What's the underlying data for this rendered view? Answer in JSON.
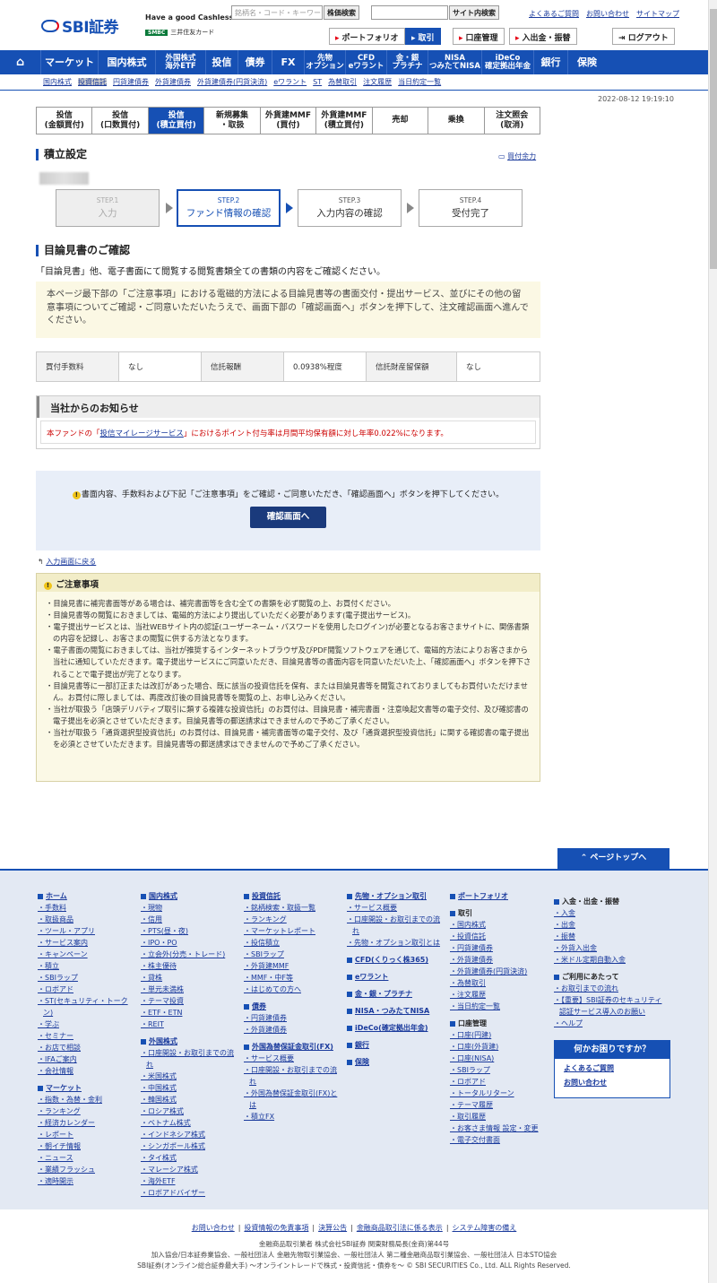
{
  "header": {
    "tagline": "Have a good Cashless.",
    "smbc": "SMBC",
    "card": "三井住友カード",
    "search_placeholder": "銘柄名・コード・キーワード",
    "stock_search": "株価検索",
    "site_search": "サイト内検索",
    "links": [
      "よくあるご質問",
      "お問い合わせ",
      "サイトマップ"
    ],
    "buttons": [
      "ポートフォリオ",
      "取引",
      "口座管理",
      "入出金・振替"
    ],
    "logout": "ログアウト"
  },
  "nav": [
    "マーケット",
    "国内株式",
    "外国株式\n海外ETF",
    "投信",
    "債券",
    "FX",
    "先物\nオプション",
    "CFD\neワラント",
    "金・銀\nプラチナ",
    "NISA\nつみたてNISA",
    "iDeCo\n確定拠出年金",
    "銀行",
    "保険"
  ],
  "subnav": [
    "国内株式",
    "投資信託",
    "円貨建債券",
    "外貨建債券",
    "外貨建債券(円貨決済)",
    "eワラント",
    "ST",
    "為替取引",
    "注文履歴",
    "当日約定一覧"
  ],
  "timestamp": "2022-08-12 19:19:10",
  "tabs": [
    "投信\n(金額買付)",
    "投信\n(口数買付)",
    "投信\n(積立買付)",
    "新規募集\n・取扱",
    "外貨建MMF\n(買付)",
    "外貨建MMF\n(積立買付)",
    "売却",
    "乗換",
    "注文照会\n(取消)"
  ],
  "section_title": "積立設定",
  "buying_power": "買付余力",
  "steps": [
    {
      "n": "STEP.1",
      "l": "入力"
    },
    {
      "n": "STEP.2",
      "l": "ファンド情報の確認"
    },
    {
      "n": "STEP.3",
      "l": "入力内容の確認"
    },
    {
      "n": "STEP.4",
      "l": "受付完了"
    }
  ],
  "prospectus_title": "目論見書のご確認",
  "lead": "「目論見書」他、電子書面にて閲覧する閲覧書類全ての書類の内容をご確認ください。",
  "notice": "本ページ最下部の「ご注意事項」における電磁的方法による目論見書等の書面交付・提出サービス、並びにその他の留意事項についてご確認・ご同意いただいたうえで、画面下部の「確認画面へ」ボタンを押下して、注文確認画面へ進んでください。",
  "fees": {
    "h1": "買付手数料",
    "v1": "なし",
    "h2": "信託報酬",
    "v2": "0.0938%程度",
    "h3": "信託財産留保額",
    "v3": "なし"
  },
  "news": {
    "title": "当社からのお知らせ",
    "pre": "本ファンドの「",
    "link": "投信マイレージサービス",
    "post": "」におけるポイント付与率は月間平均保有額に対し年率0.022%になります。"
  },
  "confirm": {
    "text": "書面内容、手数料および下記「ご注意事項」をご確認・ご同意いただき、「確認画面へ」ボタンを押下してください。",
    "button": "確認画面へ"
  },
  "back_link": "入力画面に戻る",
  "cautions": {
    "title": "ご注意事項",
    "items": [
      "目論見書に補完書面等がある場合は、補完書面等を含む全ての書類を必ず閲覧の上、お買付ください。",
      "目論見書等の閲覧におきましては、電磁的方法により提出していただく必要があります(電子提出サービス)。",
      "電子提出サービスとは、当社WEBサイト内の認証(ユーザーネーム・パスワードを使用したログイン)が必要となるお客さまサイトに、関係書類の内容を記録し、お客さまの閲覧に供する方法となります。",
      "電子書面の閲覧におきましては、当社が推奨するインターネットブラウザ及びPDF閲覧ソフトウェアを通じて、電磁的方法によりお客さまから当社に通知していただきます。電子提出サービスにご同意いただき、目論見書等の書面内容を同意いただいた上、「確認画面へ」ボタンを押下されることで電子提出が完了となります。",
      "目論見書等に一部訂正または改訂があった場合、既に該当の投資信託を保有、または目論見書等を閲覧されておりましてもお買付いただけません。お買付に際しましては、再度改訂後の目論見書等を閲覧の上、お申し込みください。",
      "当社が取扱う「店頭デリバティブ取引に類する複雑な投資信託」のお買付は、目論見書・補完書面・注意喚起文書等の電子交付、及び確認書の電子提出を必須とさせていただきます。目論見書等の郵送請求はできませんので予めご了承ください。",
      "当社が取扱う「通貨選択型投資信託」のお買付は、目論見書・補完書面等の電子交付、及び「通貨選択型投資信託」に関する確認書の電子提出を必須とさせていただきます。目論見書等の郵送請求はできませんので予めご了承ください。"
    ]
  },
  "page_top": "ページトップへ",
  "footer": {
    "col1": [
      {
        "t": "h",
        "v": "ホーム"
      },
      {
        "t": "i",
        "v": "手数料"
      },
      {
        "t": "i",
        "v": "取扱商品"
      },
      {
        "t": "i",
        "v": "ツール・アプリ"
      },
      {
        "t": "i",
        "v": "サービス案内"
      },
      {
        "t": "i",
        "v": "キャンペーン"
      },
      {
        "t": "i",
        "v": "積立"
      },
      {
        "t": "i",
        "v": "SBIラップ"
      },
      {
        "t": "i",
        "v": "ロボアド"
      },
      {
        "t": "i",
        "v": "ST(セキュリティ・トークン)"
      },
      {
        "t": "i",
        "v": "学ぶ"
      },
      {
        "t": "i",
        "v": "セミナー"
      },
      {
        "t": "i",
        "v": "お店で相談"
      },
      {
        "t": "i",
        "v": "IFAご案内"
      },
      {
        "t": "i",
        "v": "会社情報"
      },
      {
        "t": "h",
        "v": "マーケット"
      },
      {
        "t": "i",
        "v": "指数・為替・金利"
      },
      {
        "t": "i",
        "v": "ランキング"
      },
      {
        "t": "i",
        "v": "経済カレンダー"
      },
      {
        "t": "i",
        "v": "レポート"
      },
      {
        "t": "i",
        "v": "朝イチ情報"
      },
      {
        "t": "i",
        "v": "ニュース"
      },
      {
        "t": "i",
        "v": "業績フラッシュ"
      },
      {
        "t": "i",
        "v": "適時開示"
      }
    ],
    "col2": [
      {
        "t": "h",
        "v": "国内株式"
      },
      {
        "t": "i",
        "v": "現物"
      },
      {
        "t": "i",
        "v": "信用"
      },
      {
        "t": "i",
        "v": "PTS(昼・夜)"
      },
      {
        "t": "i",
        "v": "IPO・PO"
      },
      {
        "t": "i",
        "v": "立会外(分売・トレード)"
      },
      {
        "t": "i",
        "v": "株主優待"
      },
      {
        "t": "i",
        "v": "貸株"
      },
      {
        "t": "i",
        "v": "単元未満株"
      },
      {
        "t": "i",
        "v": "テーマ投資"
      },
      {
        "t": "i",
        "v": "ETF・ETN"
      },
      {
        "t": "i",
        "v": "REIT"
      },
      {
        "t": "h",
        "v": "外国株式"
      },
      {
        "t": "i",
        "v": "口座開設・お取引までの流れ"
      },
      {
        "t": "i",
        "v": "米国株式"
      },
      {
        "t": "i",
        "v": "中国株式"
      },
      {
        "t": "i",
        "v": "韓国株式"
      },
      {
        "t": "i",
        "v": "ロシア株式"
      },
      {
        "t": "i",
        "v": "ベトナム株式"
      },
      {
        "t": "i",
        "v": "インドネシア株式"
      },
      {
        "t": "i",
        "v": "シンガポール株式"
      },
      {
        "t": "i",
        "v": "タイ株式"
      },
      {
        "t": "i",
        "v": "マレーシア株式"
      },
      {
        "t": "i",
        "v": "海外ETF"
      },
      {
        "t": "i",
        "v": "ロボアドバイザー"
      }
    ],
    "col3": [
      {
        "t": "h",
        "v": "投資信託"
      },
      {
        "t": "i",
        "v": "銘柄検索・取扱一覧"
      },
      {
        "t": "i",
        "v": "ランキング"
      },
      {
        "t": "i",
        "v": "マーケットレポート"
      },
      {
        "t": "i",
        "v": "投信積立"
      },
      {
        "t": "i",
        "v": "SBIラップ"
      },
      {
        "t": "i",
        "v": "外貨建MMF"
      },
      {
        "t": "i",
        "v": "MMF・中F等"
      },
      {
        "t": "i",
        "v": "はじめての方へ"
      },
      {
        "t": "h",
        "v": "債券"
      },
      {
        "t": "i",
        "v": "円貨建債券"
      },
      {
        "t": "i",
        "v": "外貨建債券"
      },
      {
        "t": "h",
        "v": "外国為替保証金取引(FX)"
      },
      {
        "t": "i",
        "v": "サービス概要"
      },
      {
        "t": "i",
        "v": "口座開設・お取引までの流れ"
      },
      {
        "t": "i",
        "v": "外国為替保証金取引(FX)とは"
      },
      {
        "t": "i",
        "v": "積立FX"
      }
    ],
    "col4": [
      {
        "t": "h",
        "v": "先物・オプション取引"
      },
      {
        "t": "i",
        "v": "サービス概要"
      },
      {
        "t": "i",
        "v": "口座開設・お取引までの流れ"
      },
      {
        "t": "i",
        "v": "先物・オプション取引とは"
      },
      {
        "t": "h",
        "v": "CFD(くりっく株365)"
      },
      {
        "t": "h",
        "v": "eワラント"
      },
      {
        "t": "h",
        "v": "金・銀・プラチナ"
      },
      {
        "t": "h",
        "v": "NISA・つみたてNISA"
      },
      {
        "t": "h",
        "v": "iDeCo(確定拠出年金)"
      },
      {
        "t": "h",
        "v": "銀行"
      },
      {
        "t": "h",
        "v": "保険"
      }
    ],
    "col5": [
      {
        "t": "h",
        "v": "ポートフォリオ"
      },
      {
        "t": "s",
        "v": "取引"
      },
      {
        "t": "i",
        "v": "国内株式"
      },
      {
        "t": "i",
        "v": "投資信託"
      },
      {
        "t": "i",
        "v": "円貨建債券"
      },
      {
        "t": "i",
        "v": "外貨建債券"
      },
      {
        "t": "i",
        "v": "外貨建債券(円貨決済)"
      },
      {
        "t": "i",
        "v": "為替取引"
      },
      {
        "t": "i",
        "v": "注文履歴"
      },
      {
        "t": "i",
        "v": "当日約定一覧"
      },
      {
        "t": "s",
        "v": "口座管理"
      },
      {
        "t": "i",
        "v": "口座(円建)"
      },
      {
        "t": "i",
        "v": "口座(外貨建)"
      },
      {
        "t": "i",
        "v": "口座(NISA)"
      },
      {
        "t": "i",
        "v": "SBIラップ"
      },
      {
        "t": "i",
        "v": "ロボアド"
      },
      {
        "t": "i",
        "v": "トータルリターン"
      },
      {
        "t": "i",
        "v": "テーマ履歴"
      },
      {
        "t": "i",
        "v": "取引履歴"
      },
      {
        "t": "i",
        "v": "お客さま情報 設定・変更"
      },
      {
        "t": "i",
        "v": "電子交付書面"
      }
    ],
    "col6": [
      {
        "t": "s",
        "v": "入金・出金・振替"
      },
      {
        "t": "i",
        "v": "入金"
      },
      {
        "t": "i",
        "v": "出金"
      },
      {
        "t": "i",
        "v": "振替"
      },
      {
        "t": "i",
        "v": "外貨入出金"
      },
      {
        "t": "i",
        "v": "米ドル定期自動入金"
      },
      {
        "t": "s",
        "v": "ご利用にあたって"
      },
      {
        "t": "i",
        "v": "お取引までの流れ"
      },
      {
        "t": "i",
        "v": "【重要】SBI証券のセキュリティ認証サービス導入のお願い"
      },
      {
        "t": "i",
        "v": "ヘルプ"
      }
    ],
    "help_title": "何かお困りですか？",
    "help_links": [
      "よくあるご質問",
      "お問い合わせ"
    ],
    "bottom_links": [
      "お問い合わせ",
      "投資情報の免責事項",
      "決算公告",
      "金融商品取引法に係る表示",
      "システム障害の備え"
    ],
    "copy1": "金融商品取引業者 株式会社SBI証券 関東財務局長(金商)第44号",
    "copy2": "加入協会/日本証券業協会、一般社団法人 金融先物取引業協会、一般社団法人 第二種金融商品取引業協会、一般社団法人 日本STO協会",
    "copy3": "SBI証券(オンライン総合証券最大手) ～オンライントレードで株式・投資信託・債券を～ © SBI SECURITIES Co., Ltd. ALL Rights Reserved."
  }
}
